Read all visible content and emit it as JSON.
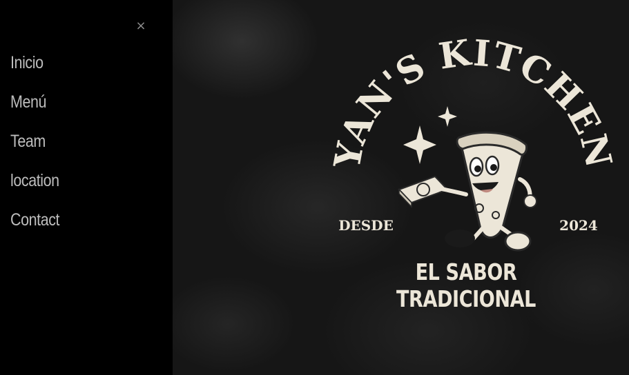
{
  "sidebar": {
    "close_label": "×",
    "items": [
      {
        "label": "Inicio"
      },
      {
        "label": "Menú"
      },
      {
        "label": "Team"
      },
      {
        "label": "location"
      },
      {
        "label": "Contact"
      }
    ]
  },
  "hero": {
    "logo": {
      "brand_name": "YAN'S KITCHEN",
      "left_caption": "DESDE",
      "right_caption": "2024",
      "mascot": "pizza-slice-mascot",
      "decorations": [
        "sparkle-icon",
        "pizza-box"
      ]
    },
    "tagline": "EL SABOR TRADICIONAL"
  },
  "colors": {
    "sidebar_bg": "#000000",
    "nav_text": "#bdbdbd",
    "logo_cream": "#ece6d8",
    "hero_bg": "#161616"
  }
}
